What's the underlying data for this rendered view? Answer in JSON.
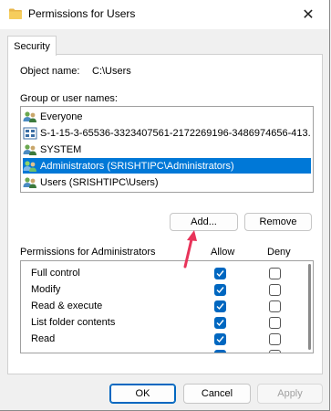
{
  "window": {
    "title": "Permissions for Users",
    "close_glyph": "✕"
  },
  "tab": {
    "label": "Security"
  },
  "object": {
    "label": "Object name:",
    "value": "C:\\Users"
  },
  "group": {
    "label": "Group or user names:",
    "items": [
      {
        "label": "Everyone",
        "icon": "users-group-icon",
        "selected": false
      },
      {
        "label": "S-1-15-3-65536-3323407561-2172269196-3486974656-413...",
        "icon": "sid-icon",
        "selected": false
      },
      {
        "label": "SYSTEM",
        "icon": "users-group-icon",
        "selected": false
      },
      {
        "label": "Administrators (SRISHTIPC\\Administrators)",
        "icon": "users-group-icon",
        "selected": true
      },
      {
        "label": "Users (SRISHTIPC\\Users)",
        "icon": "users-group-icon",
        "selected": false
      }
    ]
  },
  "buttons": {
    "add": "Add...",
    "remove": "Remove",
    "ok": "OK",
    "cancel": "Cancel",
    "apply": "Apply"
  },
  "permissions": {
    "title": "Permissions for Administrators",
    "allow_header": "Allow",
    "deny_header": "Deny",
    "rows": [
      {
        "name": "Full control",
        "allow": true,
        "deny": false
      },
      {
        "name": "Modify",
        "allow": true,
        "deny": false
      },
      {
        "name": "Read & execute",
        "allow": true,
        "deny": false
      },
      {
        "name": "List folder contents",
        "allow": true,
        "deny": false
      },
      {
        "name": "Read",
        "allow": true,
        "deny": false
      },
      {
        "name": "",
        "allow": true,
        "deny": false
      }
    ]
  },
  "colors": {
    "accent": "#0067c0",
    "selection": "#0078d7",
    "annotation_arrow": "#e8345a"
  }
}
